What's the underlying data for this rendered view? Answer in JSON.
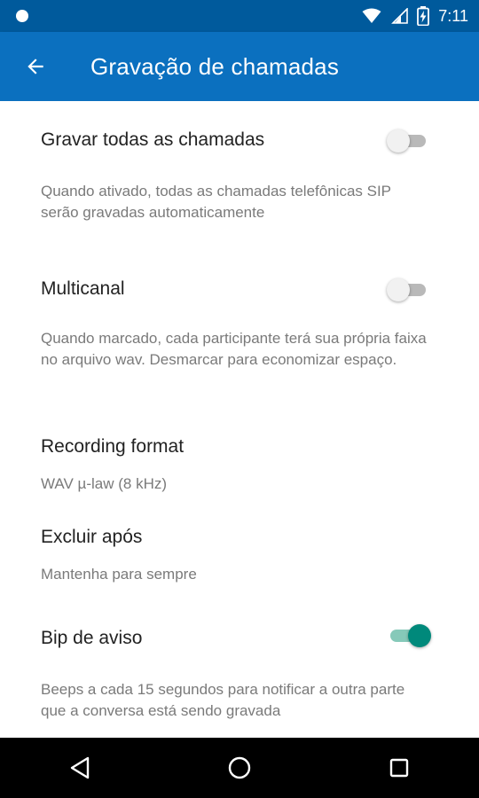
{
  "status_bar": {
    "time": "7:11",
    "icons": [
      "notification-dot-icon",
      "wifi-icon",
      "signal-icon",
      "battery-charging-icon"
    ]
  },
  "app_bar": {
    "title": "Gravação de chamadas",
    "back_icon": "arrow-back-icon",
    "color": "#0b70bf"
  },
  "settings": [
    {
      "title": "Gravar todas as chamadas",
      "summary": "Quando ativado, todas as chamadas telefônicas SIP serão gravadas automaticamente",
      "toggle": false
    },
    {
      "title": "Multicanal",
      "summary": "Quando marcado, cada participante terá sua própria faixa no arquivo wav. Desmarcar para economizar espaço.",
      "toggle": false
    },
    {
      "title": "Recording format",
      "summary": "WAV µ-law (8 kHz)"
    },
    {
      "title": "Excluir após",
      "summary": "Mantenha para sempre"
    },
    {
      "title": "Bip de aviso",
      "summary": "Beeps a cada 15 segundos para notificar a outra parte que a conversa está sendo gravada",
      "toggle": true
    }
  ],
  "nav_bar": {
    "icons": [
      "back-triangle-icon",
      "home-circle-icon",
      "recents-square-icon"
    ]
  },
  "colors": {
    "accent": "#00897b",
    "status_bar": "#005a9c"
  }
}
